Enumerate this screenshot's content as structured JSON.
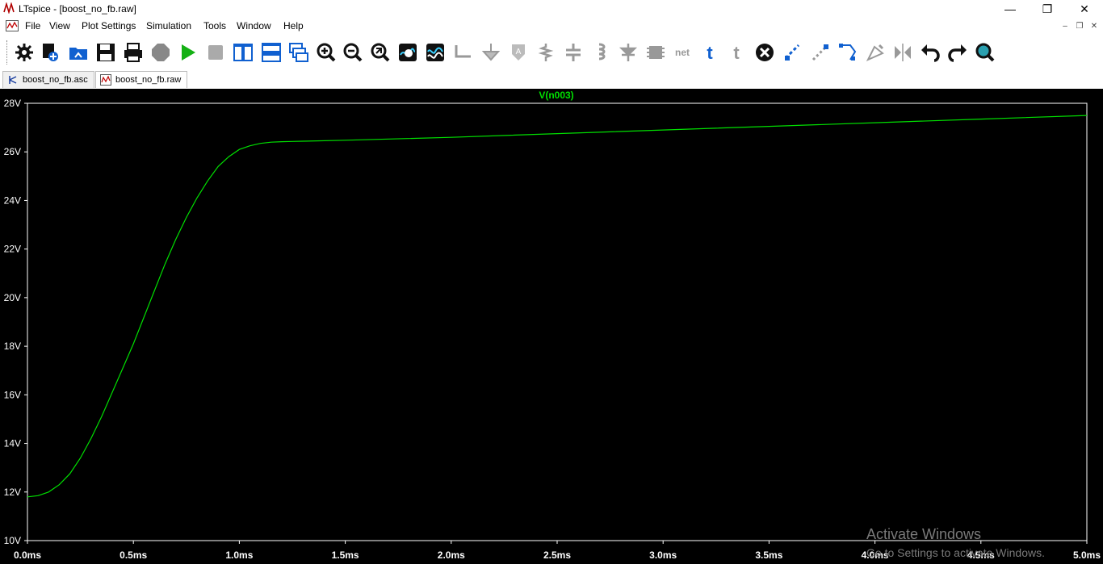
{
  "window": {
    "title": "LTspice - [boost_no_fb.raw]"
  },
  "menubar": {
    "items": [
      "File",
      "View",
      "Plot Settings",
      "Simulation",
      "Tools",
      "Window",
      "Help"
    ]
  },
  "toolbar": {
    "icons": [
      "gear-icon",
      "new-schematic-icon",
      "open-icon",
      "save-icon",
      "print-icon",
      "stop-sign-icon",
      "run-icon",
      "halt-icon",
      "tile-vertical-icon",
      "tile-horizontal-icon",
      "cascade-icon",
      "zoom-in-icon",
      "zoom-out-icon",
      "zoom-fit-icon",
      "autorange-icon",
      "waveform-icon",
      "wire-icon",
      "ground-icon",
      "net-label-icon",
      "resistor-icon",
      "capacitor-icon",
      "inductor-icon",
      "diode-icon",
      "component-icon",
      "net-icon",
      "text-icon",
      "spice-directive-icon",
      "delete-icon",
      "duplicate-icon",
      "move-icon",
      "drag-icon",
      "rotate-icon",
      "mirror-icon",
      "undo-icon",
      "redo-icon",
      "find-icon"
    ]
  },
  "tabs": [
    {
      "label": "boost_no_fb.asc",
      "icon": "schematic-icon"
    },
    {
      "label": "boost_no_fb.raw",
      "icon": "waveform-file-icon"
    }
  ],
  "colors": {
    "trace": "#00e000",
    "background": "#000000",
    "axis": "#ffffff"
  },
  "watermark": {
    "line1": "Activate Windows",
    "line2": "Go to Settings to activate Windows."
  },
  "chart_data": {
    "type": "line",
    "title": "V(n003)",
    "xlabel": "",
    "ylabel": "",
    "xlim": [
      0,
      5
    ],
    "ylim": [
      10,
      28
    ],
    "x_unit": "ms",
    "y_unit": "V",
    "yticks": [
      "10V",
      "12V",
      "14V",
      "16V",
      "18V",
      "20V",
      "22V",
      "24V",
      "26V",
      "28V"
    ],
    "xticks": [
      "0.0ms",
      "0.5ms",
      "1.0ms",
      "1.5ms",
      "2.0ms",
      "2.5ms",
      "3.0ms",
      "3.5ms",
      "4.0ms",
      "4.5ms",
      "5.0ms"
    ],
    "grid": false,
    "series": [
      {
        "name": "V(n003)",
        "color": "#00e000",
        "x": [
          0,
          0.05,
          0.1,
          0.15,
          0.2,
          0.25,
          0.3,
          0.35,
          0.4,
          0.45,
          0.5,
          0.55,
          0.6,
          0.65,
          0.7,
          0.75,
          0.8,
          0.85,
          0.9,
          0.95,
          1.0,
          1.05,
          1.1,
          1.15,
          1.2,
          1.25,
          1.3,
          1.5,
          2.0,
          2.5,
          3.0,
          3.5,
          4.0,
          4.5,
          5.0
        ],
        "y": [
          11.8,
          11.85,
          12.0,
          12.3,
          12.75,
          13.4,
          14.2,
          15.1,
          16.1,
          17.1,
          18.1,
          19.2,
          20.3,
          21.4,
          22.4,
          23.3,
          24.1,
          24.8,
          25.4,
          25.8,
          26.1,
          26.25,
          26.35,
          26.4,
          26.42,
          26.43,
          26.44,
          26.48,
          26.6,
          26.75,
          26.9,
          27.05,
          27.2,
          27.35,
          27.5
        ]
      }
    ]
  }
}
